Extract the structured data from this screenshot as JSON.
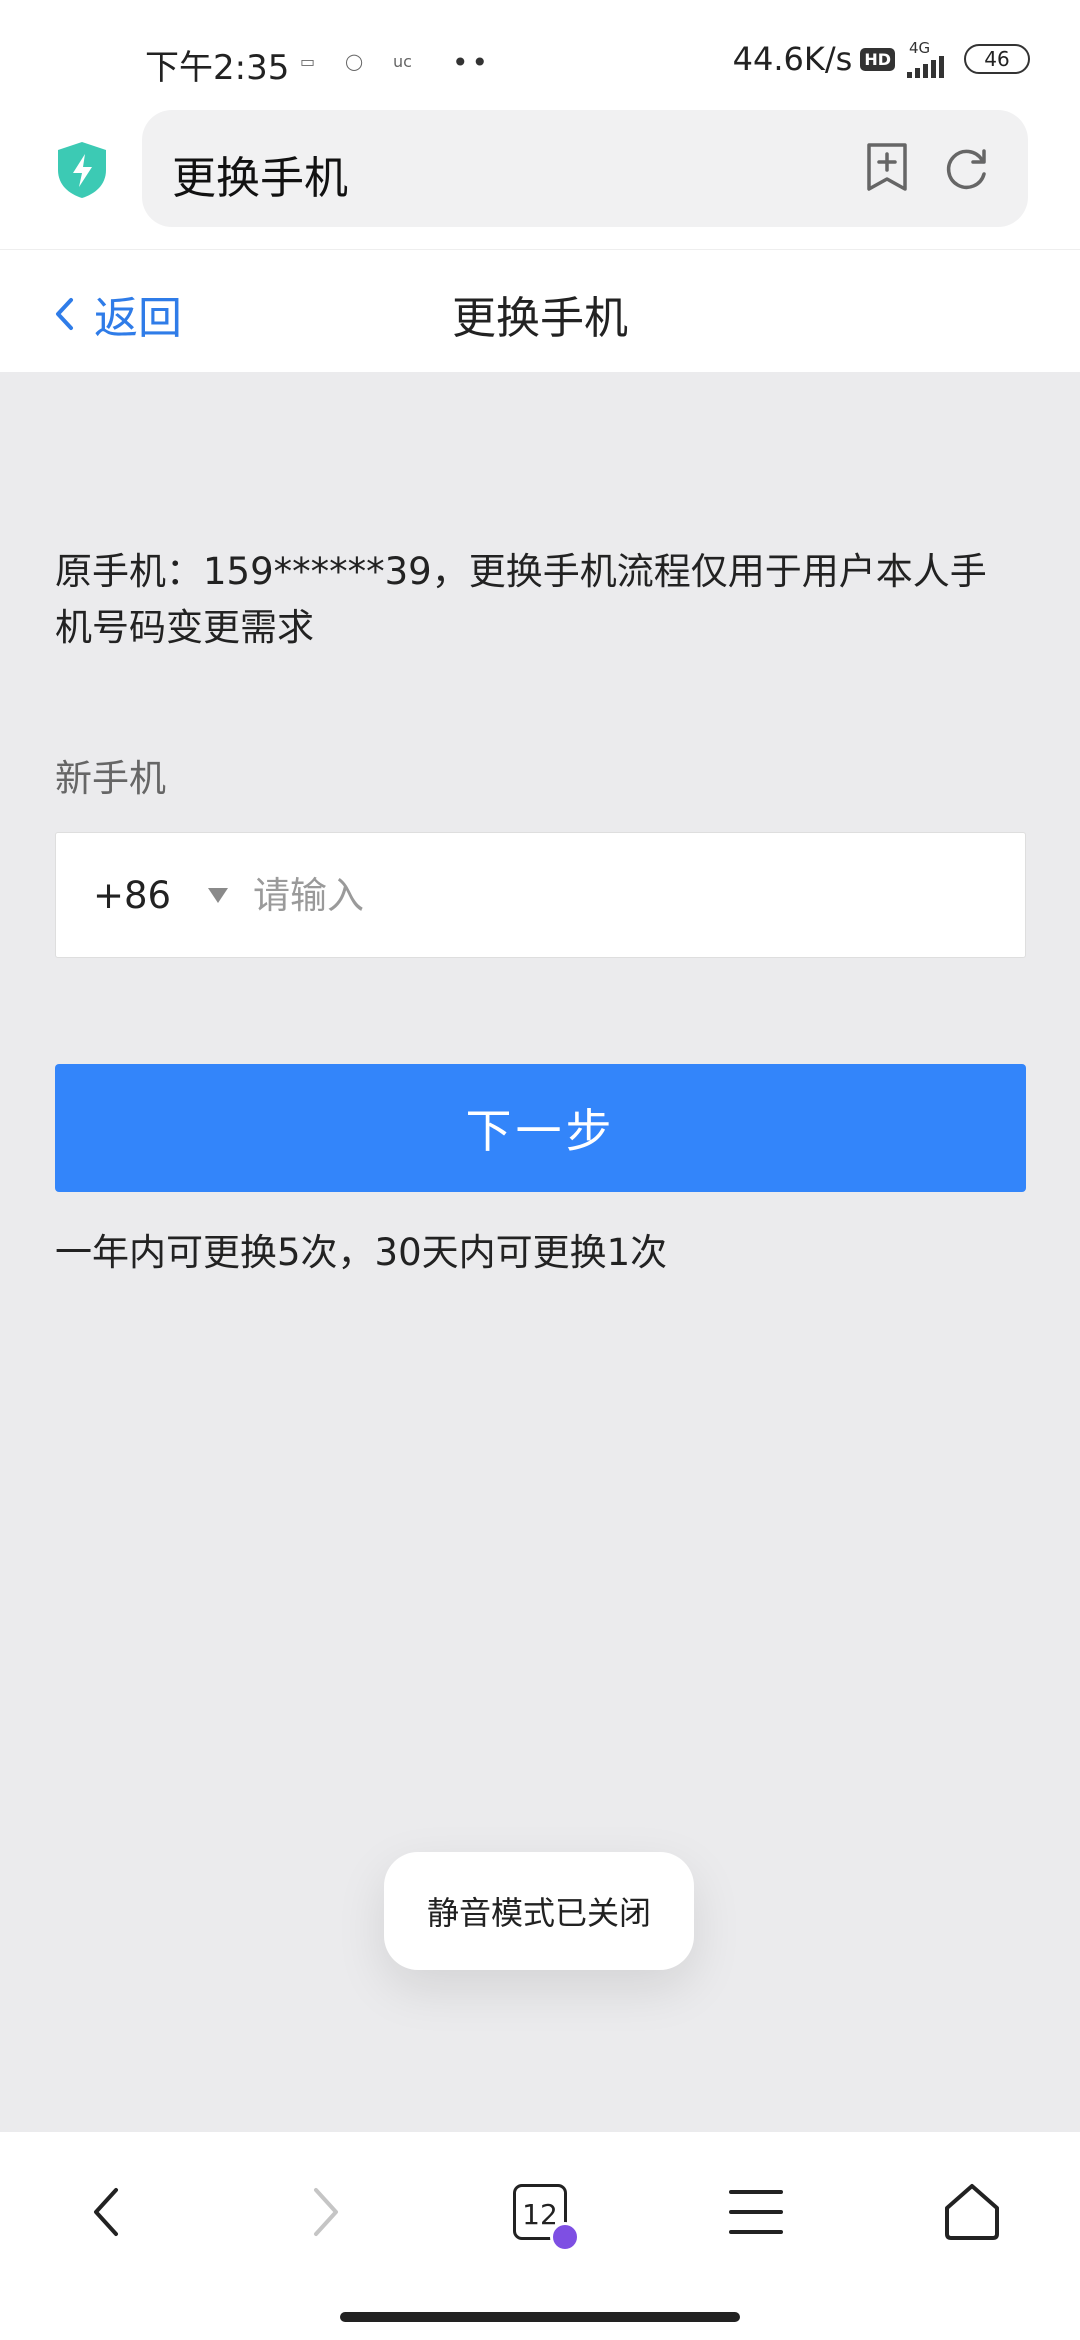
{
  "status_bar": {
    "time": "下午2:35",
    "notification_icons": [
      "message-icon",
      "qq-icon",
      "uc-icon"
    ],
    "notification_glyphs": [
      "▭",
      "◯",
      "uc"
    ],
    "more_dots": "••",
    "net_speed": "44.6K/s",
    "hd_label": "HD",
    "network_type": "4G",
    "battery": "46"
  },
  "browser": {
    "url_title": "更换手机",
    "security_icon": "shield-bolt-icon",
    "actions": [
      "bookmark-add-icon",
      "refresh-icon"
    ]
  },
  "header": {
    "back_label": "返回",
    "title": "更换手机"
  },
  "form": {
    "original_phone_text": "原手机：159******39，更换手机流程仅用于用户本人手机号码变更需求",
    "new_phone_label": "新手机",
    "country_code": "+86",
    "phone_value": "",
    "phone_placeholder": "请输入",
    "next_button_label": "下一步",
    "limit_note": "一年内可更换5次，30天内可更换1次"
  },
  "toast": {
    "message": "静音模式已关闭"
  },
  "bottom_nav": {
    "tab_count": "12",
    "items": [
      "back-icon",
      "forward-icon",
      "tabs-icon",
      "menu-icon",
      "home-icon"
    ]
  },
  "colors": {
    "accent": "#3385fa",
    "link": "#2f7ce8",
    "shield": "#3ccab4",
    "badge": "#7e4fe3",
    "page_bg": "#ebebed"
  }
}
